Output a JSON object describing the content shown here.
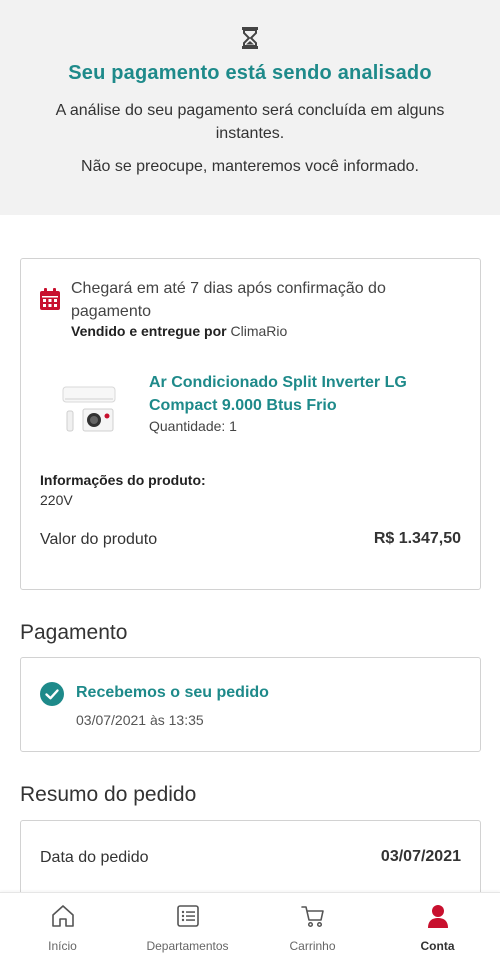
{
  "status": {
    "icon": "hourglass-icon",
    "title": "Seu pagamento está sendo analisado",
    "text1": "A análise do seu pagamento será concluída em alguns instantes.",
    "text2": "Não se preocupe, manteremos você informado."
  },
  "delivery": {
    "icon": "calendar-icon",
    "title": "Chegará em até 7 dias após confirmação do pagamento",
    "seller_label": "Vendido e entregue por",
    "seller_name": "ClimaRio",
    "product": {
      "name": "Ar Condicionado Split Inverter LG Compact 9.000 Btus Frio",
      "quantity": "Quantidade: 1"
    },
    "info_label": "Informações do produto:",
    "info_value": "220V",
    "price_label": "Valor do produto",
    "price_value": "R$ 1.347,50"
  },
  "payment": {
    "section_title": "Pagamento",
    "status": "Recebemos o seu pedido",
    "date": "03/07/2021 às 13:35"
  },
  "summary": {
    "section_title": "Resumo do pedido",
    "order_date_label": "Data do pedido",
    "order_date_value": "03/07/2021"
  },
  "nav": {
    "items": [
      {
        "label": "Início",
        "icon": "home-icon"
      },
      {
        "label": "Departamentos",
        "icon": "list-icon"
      },
      {
        "label": "Carrinho",
        "icon": "cart-icon"
      },
      {
        "label": "Conta",
        "icon": "user-icon"
      }
    ],
    "active": "Conta"
  },
  "colors": {
    "accent": "#1e8a8a",
    "brand_red": "#c8102e",
    "banner_bg": "#f2f2f2"
  }
}
